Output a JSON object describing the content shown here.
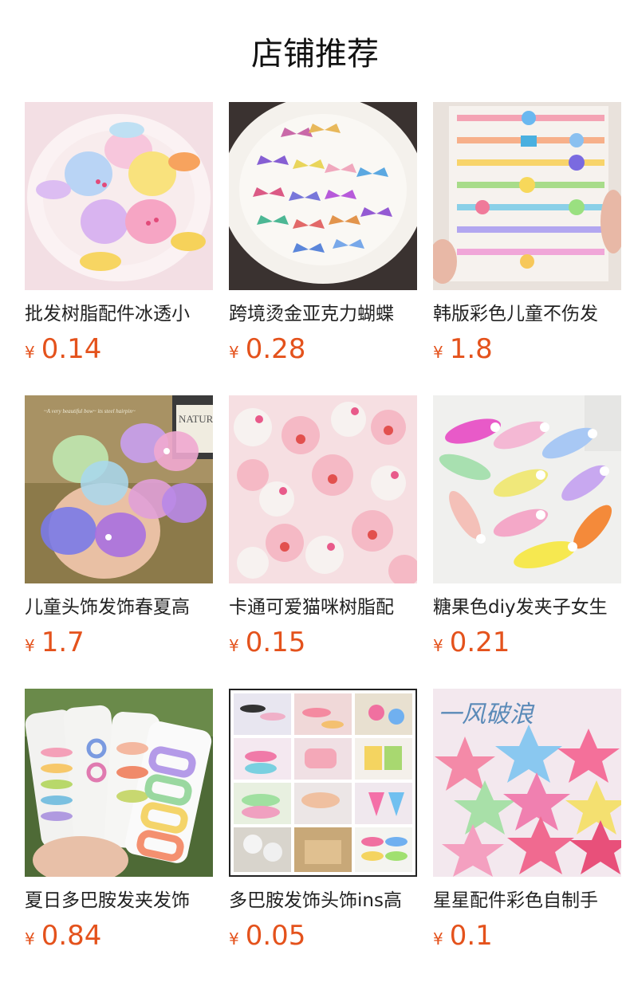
{
  "header": {
    "title": "店铺推荐"
  },
  "products": [
    {
      "name": "批发树脂配件冰透小",
      "currency": "¥",
      "price": "0.14"
    },
    {
      "name": "跨境烫金亚克力蝴蝶",
      "currency": "¥",
      "price": "0.28"
    },
    {
      "name": "韩版彩色儿童不伤发",
      "currency": "¥",
      "price": "1.8"
    },
    {
      "name": "儿童头饰发饰春夏高",
      "currency": "¥",
      "price": "1.7"
    },
    {
      "name": "卡通可爱猫咪树脂配",
      "currency": "¥",
      "price": "0.15"
    },
    {
      "name": "糖果色diy发夹子女生",
      "currency": "¥",
      "price": "0.21"
    },
    {
      "name": "夏日多巴胺发夹发饰",
      "currency": "¥",
      "price": "0.84"
    },
    {
      "name": "多巴胺发饰头饰ins高",
      "currency": "¥",
      "price": "0.05"
    },
    {
      "name": "星星配件彩色自制手",
      "currency": "¥",
      "price": "0.1"
    }
  ],
  "image_overlays": {
    "butterfly_caption": "~A very beautiful bow~ its steel hairpin~",
    "book_text": "NATUR",
    "star_handwriting": "一风破浪"
  },
  "colors": {
    "price": "#e4521c",
    "title": "#111111"
  }
}
